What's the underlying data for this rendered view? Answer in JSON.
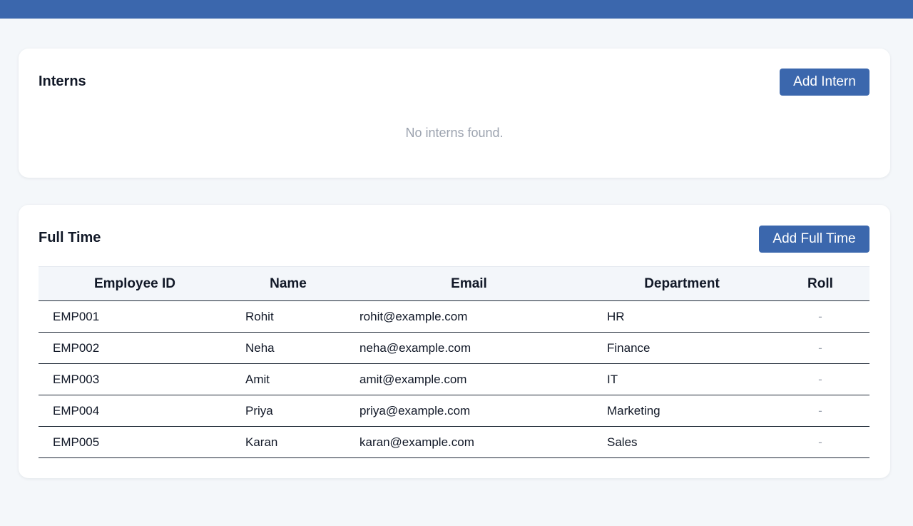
{
  "interns": {
    "title": "Interns",
    "add_button": "Add Intern",
    "empty_message": "No interns found."
  },
  "fulltime": {
    "title": "Full Time",
    "add_button": "Add Full Time",
    "columns": [
      "Employee ID",
      "Name",
      "Email",
      "Department",
      "Roll"
    ],
    "rows": [
      {
        "id": "EMP001",
        "name": "Rohit",
        "email": "rohit@example.com",
        "department": "HR",
        "roll": "-"
      },
      {
        "id": "EMP002",
        "name": "Neha",
        "email": "neha@example.com",
        "department": "Finance",
        "roll": "-"
      },
      {
        "id": "EMP003",
        "name": "Amit",
        "email": "amit@example.com",
        "department": "IT",
        "roll": "-"
      },
      {
        "id": "EMP004",
        "name": "Priya",
        "email": "priya@example.com",
        "department": "Marketing",
        "roll": "-"
      },
      {
        "id": "EMP005",
        "name": "Karan",
        "email": "karan@example.com",
        "department": "Sales",
        "roll": "-"
      }
    ]
  },
  "colors": {
    "accent": "#3b67ad",
    "background": "#f4f7fa",
    "muted_text": "#9ca3af"
  }
}
